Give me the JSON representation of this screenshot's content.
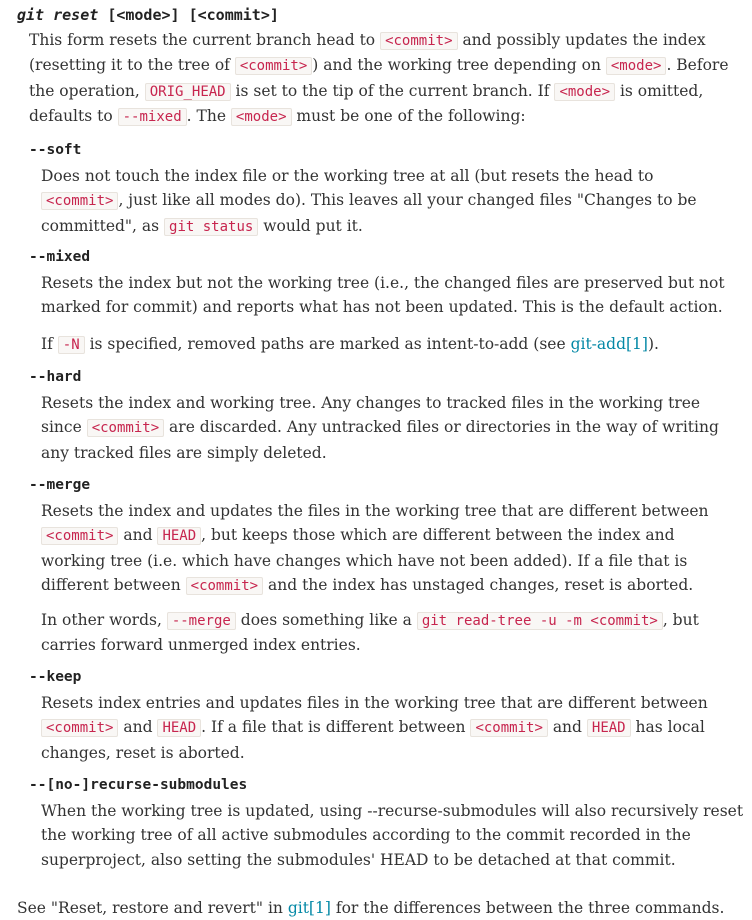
{
  "header": {
    "command": "git reset",
    "args": "[<mode>] [<commit>]"
  },
  "intro": {
    "t1": "This form resets the current branch head to ",
    "c1": "<commit>",
    "t2": " and possibly updates the index (resetting it to the tree of ",
    "c2": "<commit>",
    "t3": ") and the working tree depending on ",
    "c3": "<mode>",
    "t4": ". Before the operation, ",
    "c4": "ORIG_HEAD",
    "t5": " is set to the tip of the current branch. If ",
    "c5": "<mode>",
    "t6": " is omitted, defaults to ",
    "c6": "--mixed",
    "t7": ". The ",
    "c7": "<mode>",
    "t8": " must be one of the following:"
  },
  "soft": {
    "term": "--soft",
    "t1": "Does not touch the index file or the working tree at all (but resets the head to ",
    "c1": "<commit>",
    "t2": ", just like all modes do). This leaves all your changed files \"Changes to be committed\", as ",
    "c2": "git status",
    "t3": " would put it."
  },
  "mixed": {
    "term": "--mixed",
    "p1": "Resets the index but not the working tree (i.e., the changed files are preserved but not marked for commit) and reports what has not been updated. This is the default action.",
    "t1": "If ",
    "c1": "-N",
    "t2": " is specified, removed paths are marked as intent-to-add (see ",
    "link": "git-add[1]",
    "t3": ")."
  },
  "hard": {
    "term": "--hard",
    "t1": "Resets the index and working tree. Any changes to tracked files in the working tree since ",
    "c1": "<commit>",
    "t2": " are discarded. Any untracked files or directories in the way of writing any tracked files are simply deleted."
  },
  "merge": {
    "term": "--merge",
    "t1": "Resets the index and updates the files in the working tree that are different between ",
    "c1": "<commit>",
    "t2": " and ",
    "c2": "HEAD",
    "t3": ", but keeps those which are different between the index and working tree (i.e. which have changes which have not been added). If a file that is different between ",
    "c3": "<commit>",
    "t4": " and the index has unstaged changes, reset is aborted.",
    "u1": "In other words, ",
    "d1": "--merge",
    "u2": " does something like a ",
    "d2": "git read-tree -u -m <commit>",
    "u3": ", but carries forward unmerged index entries."
  },
  "keep": {
    "term": "--keep",
    "t1": "Resets index entries and updates files in the working tree that are different between ",
    "c1": "<commit>",
    "t2": " and ",
    "c2": "HEAD",
    "t3": ". If a file that is different between ",
    "c3": "<commit>",
    "t4": " and ",
    "c4": "HEAD",
    "t5": " has local changes, reset is aborted."
  },
  "recurse": {
    "term": "--[no-]recurse-submodules",
    "p1": "When the working tree is updated, using --recurse-submodules will also recursively reset the working tree of all active submodules according to the commit recorded in the superproject, also setting the submodules' HEAD to be detached at that commit."
  },
  "footer": {
    "t1": "See \"Reset, restore and revert\" in ",
    "link": "git[1]",
    "t2": " for the differences between the three commands."
  }
}
